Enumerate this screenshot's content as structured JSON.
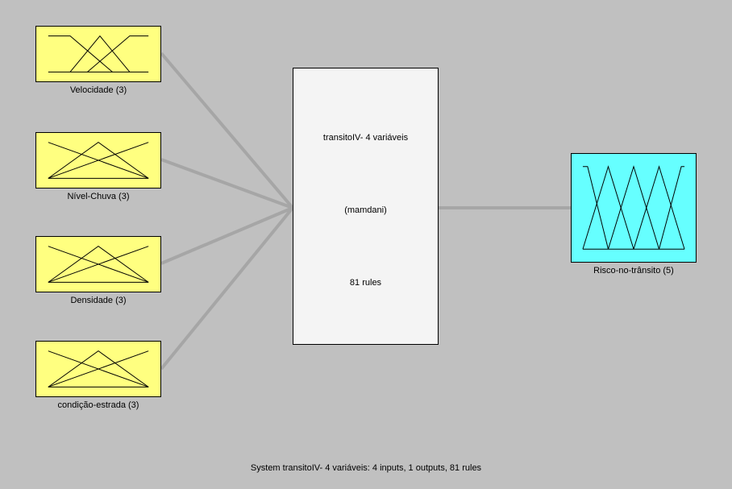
{
  "system": {
    "name": "transitoIV- 4 variáveis",
    "type_label": "(mamdani)",
    "rules_label": "81 rules",
    "footer": "System transitoIV- 4 variáveis: 4 inputs, 1 outputs, 81 rules"
  },
  "inputs": [
    {
      "label": "Velocidade (3)"
    },
    {
      "label": "Nível-Chuva (3)"
    },
    {
      "label": "Densidade (3)"
    },
    {
      "label": "condição-estrada (3)"
    }
  ],
  "output": {
    "label": "Risco-no-trânsito (5)"
  }
}
